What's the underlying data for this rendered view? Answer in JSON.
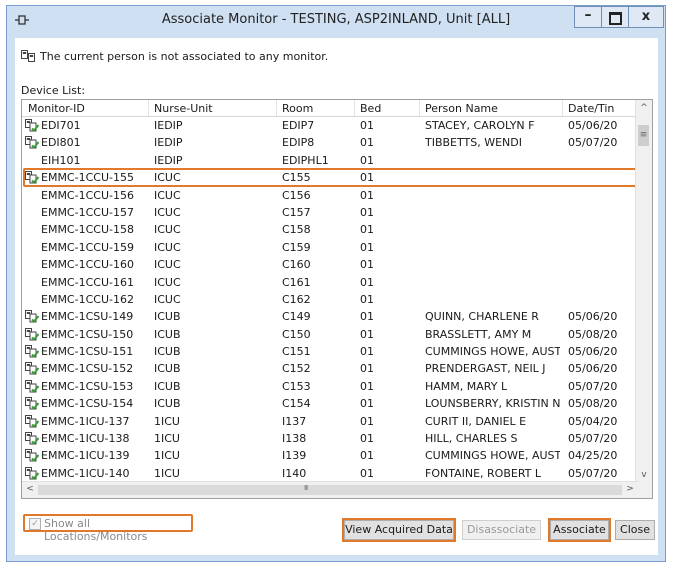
{
  "window": {
    "title": "Associate Monitor - TESTING, ASP2INLAND, Unit [ALL]",
    "minimize": "–",
    "close": "x"
  },
  "status_message": "The current person is not associated to any monitor.",
  "device_list_label": "Device List:",
  "columns": [
    "Monitor-ID",
    "Nurse-Unit",
    "Room",
    "Bed",
    "Person Name",
    "Date/Tin"
  ],
  "rows": [
    {
      "icon": "monitor-person-icon",
      "monitor_id": "EDI701",
      "nurse_unit": "IEDIP",
      "room": "EDIP7",
      "bed": "01",
      "person": "STACEY, CAROLYN F",
      "date": "05/06/20"
    },
    {
      "icon": "monitor-person-icon",
      "monitor_id": "EDI801",
      "nurse_unit": "IEDIP",
      "room": "EDIP8",
      "bed": "01",
      "person": "TIBBETTS, WENDI",
      "date": "05/07/20"
    },
    {
      "icon": "",
      "monitor_id": "EIH101",
      "nurse_unit": "IEDIP",
      "room": "EDIPHL1",
      "bed": "01",
      "person": "",
      "date": ""
    },
    {
      "icon": "monitor-person-icon",
      "monitor_id": "EMMC-1CCU-155",
      "nurse_unit": "ICUC",
      "room": "C155",
      "bed": "01",
      "person": "",
      "date": "",
      "selected": true
    },
    {
      "icon": "",
      "monitor_id": "EMMC-1CCU-156",
      "nurse_unit": "ICUC",
      "room": "C156",
      "bed": "01",
      "person": "",
      "date": ""
    },
    {
      "icon": "",
      "monitor_id": "EMMC-1CCU-157",
      "nurse_unit": "ICUC",
      "room": "C157",
      "bed": "01",
      "person": "",
      "date": ""
    },
    {
      "icon": "",
      "monitor_id": "EMMC-1CCU-158",
      "nurse_unit": "ICUC",
      "room": "C158",
      "bed": "01",
      "person": "",
      "date": ""
    },
    {
      "icon": "",
      "monitor_id": "EMMC-1CCU-159",
      "nurse_unit": "ICUC",
      "room": "C159",
      "bed": "01",
      "person": "",
      "date": ""
    },
    {
      "icon": "",
      "monitor_id": "EMMC-1CCU-160",
      "nurse_unit": "ICUC",
      "room": "C160",
      "bed": "01",
      "person": "",
      "date": ""
    },
    {
      "icon": "",
      "monitor_id": "EMMC-1CCU-161",
      "nurse_unit": "ICUC",
      "room": "C161",
      "bed": "01",
      "person": "",
      "date": ""
    },
    {
      "icon": "",
      "monitor_id": "EMMC-1CCU-162",
      "nurse_unit": "ICUC",
      "room": "C162",
      "bed": "01",
      "person": "",
      "date": ""
    },
    {
      "icon": "monitor-person-icon",
      "monitor_id": "EMMC-1CSU-149",
      "nurse_unit": "ICUB",
      "room": "C149",
      "bed": "01",
      "person": "QUINN, CHARLENE R",
      "date": "05/06/20"
    },
    {
      "icon": "monitor-person-icon",
      "monitor_id": "EMMC-1CSU-150",
      "nurse_unit": "ICUB",
      "room": "C150",
      "bed": "01",
      "person": "BRASSLETT, AMY M",
      "date": "05/08/20"
    },
    {
      "icon": "monitor-person-icon",
      "monitor_id": "EMMC-1CSU-151",
      "nurse_unit": "ICUB",
      "room": "C151",
      "bed": "01",
      "person": "CUMMINGS HOWE, AUST...",
      "date": "05/06/20"
    },
    {
      "icon": "monitor-person-icon",
      "monitor_id": "EMMC-1CSU-152",
      "nurse_unit": "ICUB",
      "room": "C152",
      "bed": "01",
      "person": "PRENDERGAST, NEIL J",
      "date": "05/06/20"
    },
    {
      "icon": "monitor-person-icon",
      "monitor_id": "EMMC-1CSU-153",
      "nurse_unit": "ICUB",
      "room": "C153",
      "bed": "01",
      "person": "HAMM, MARY L",
      "date": "05/07/20"
    },
    {
      "icon": "monitor-person-icon",
      "monitor_id": "EMMC-1CSU-154",
      "nurse_unit": "ICUB",
      "room": "C154",
      "bed": "01",
      "person": "LOUNSBERRY, KRISTIN N",
      "date": "05/08/20"
    },
    {
      "icon": "monitor-person-icon",
      "monitor_id": "EMMC-1ICU-137",
      "nurse_unit": "1ICU",
      "room": "I137",
      "bed": "01",
      "person": "CURIT II, DANIEL E",
      "date": "05/04/20"
    },
    {
      "icon": "monitor-person-icon",
      "monitor_id": "EMMC-1ICU-138",
      "nurse_unit": "1ICU",
      "room": "I138",
      "bed": "01",
      "person": "HILL, CHARLES S",
      "date": "05/07/20"
    },
    {
      "icon": "monitor-person-icon",
      "monitor_id": "EMMC-1ICU-139",
      "nurse_unit": "1ICU",
      "room": "I139",
      "bed": "01",
      "person": "CUMMINGS HOWE, AUST...",
      "date": "04/25/20"
    },
    {
      "icon": "monitor-person-icon",
      "monitor_id": "EMMC-1ICU-140",
      "nurse_unit": "1ICU",
      "room": "I140",
      "bed": "01",
      "person": "FONTAINE, ROBERT L",
      "date": "05/07/20"
    }
  ],
  "show_all_label": "Show all Locations/Monitors",
  "show_all_checked": true,
  "buttons": {
    "view_acquired": "View Acquired Data",
    "disassociate": "Disassociate",
    "associate": "Associate",
    "close": "Close"
  },
  "scroll_glyphs": {
    "up": "^",
    "down": "v",
    "left": "<",
    "right": ">",
    "grip": "III",
    "vgrip": "≡"
  },
  "colors": {
    "highlight": "#e07a2a",
    "window_frame": "#cfe0f3",
    "icon_green": "#3c9a3c"
  }
}
